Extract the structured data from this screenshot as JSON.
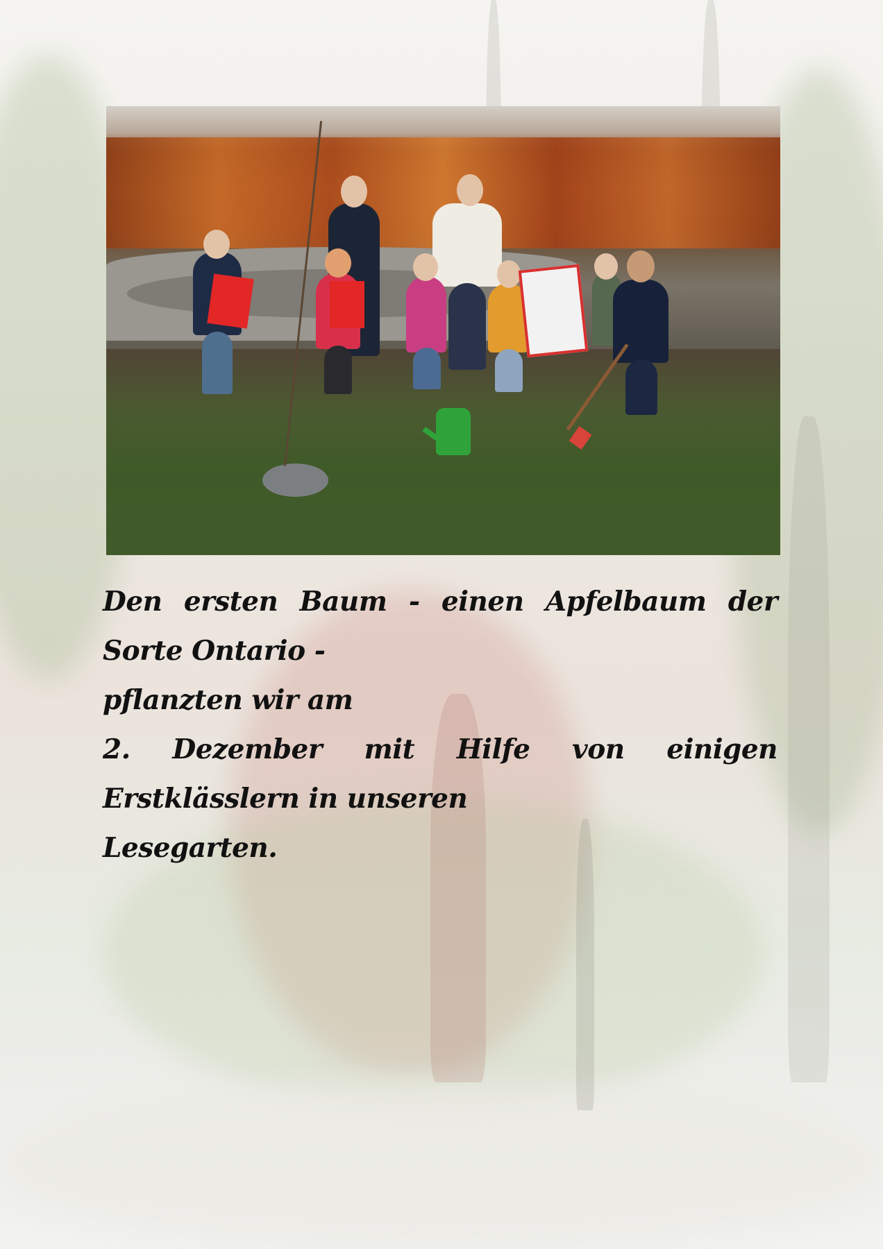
{
  "caption": {
    "lines": [
      "Den ersten Baum - einen Apfelbaum der Sorte Ontario -",
      "pflanzten wir am",
      "2. Dezember mit Hilfe von einigen Erstklässlern in unseren",
      "Lesegarten."
    ]
  }
}
